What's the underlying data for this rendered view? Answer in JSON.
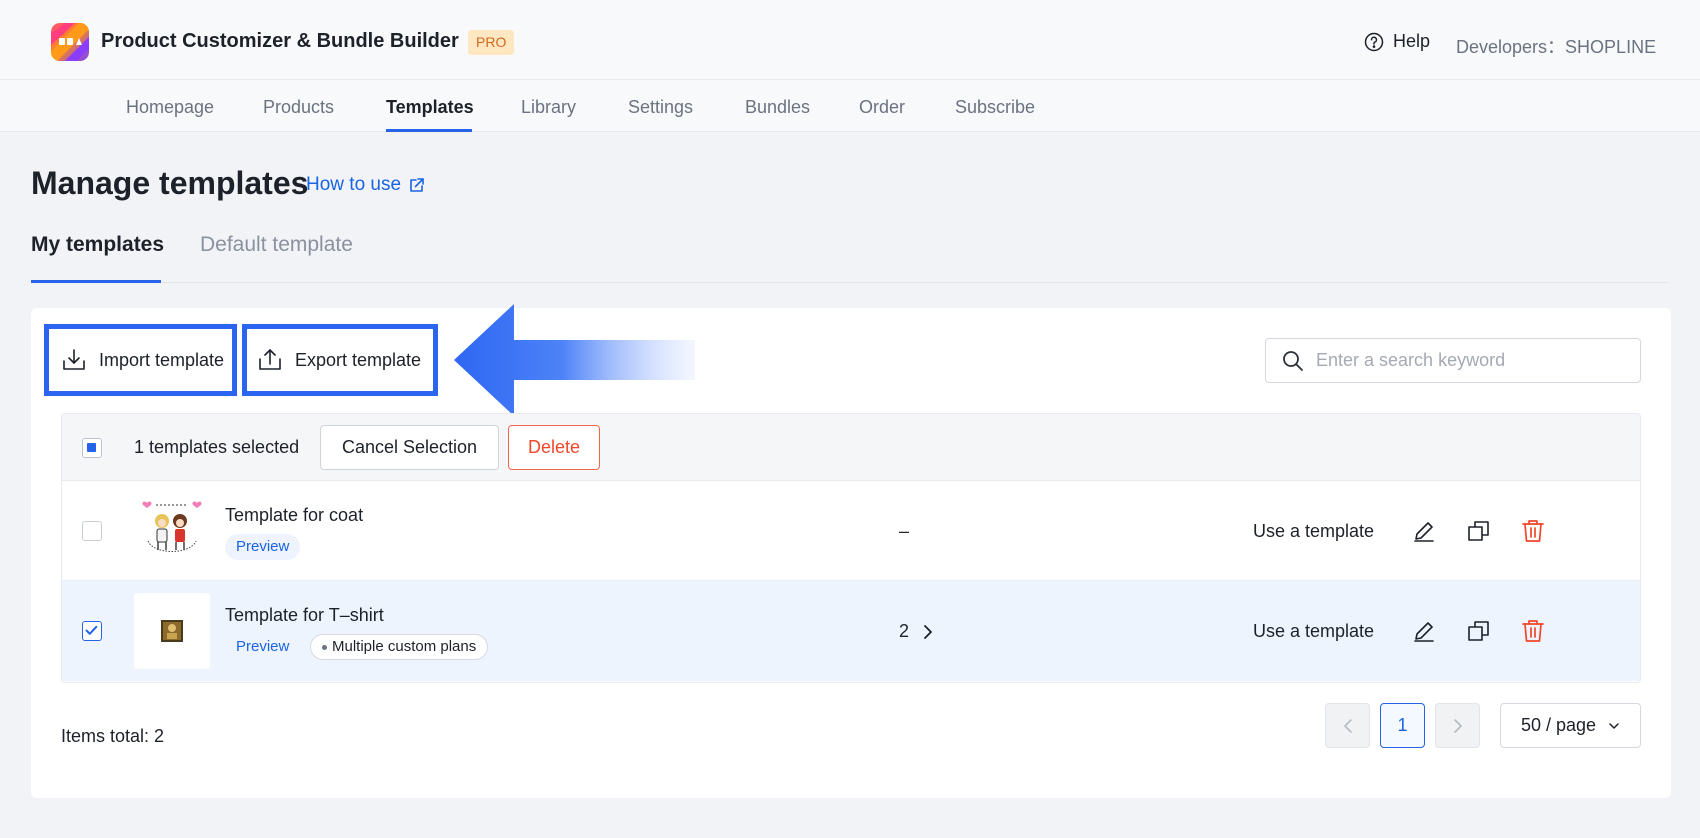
{
  "app": {
    "title": "Product Customizer & Bundle Builder",
    "badge": "PRO",
    "help_label": "Help",
    "developer_label": "Developers：SHOPLINE"
  },
  "nav": {
    "items": [
      {
        "label": "Homepage",
        "active": false
      },
      {
        "label": "Products",
        "active": false
      },
      {
        "label": "Templates",
        "active": true
      },
      {
        "label": "Library",
        "active": false
      },
      {
        "label": "Settings",
        "active": false
      },
      {
        "label": "Bundles",
        "active": false
      },
      {
        "label": "Order",
        "active": false
      },
      {
        "label": "Subscribe",
        "active": false
      }
    ]
  },
  "page": {
    "title": "Manage templates",
    "how_to_label": "How to use",
    "tabs": [
      {
        "label": "My templates",
        "active": true
      },
      {
        "label": "Default template",
        "active": false
      }
    ]
  },
  "toolbar": {
    "import_label": "Import template",
    "export_label": "Export template",
    "search_placeholder": "Enter a search keyword",
    "search_value": ""
  },
  "selection": {
    "text": "1 templates selected",
    "cancel_label": "Cancel Selection",
    "delete_label": "Delete"
  },
  "rows": [
    {
      "name": "Template for coat",
      "preview_label": "Preview",
      "tag": "",
      "count": "–",
      "use_label": "Use a template",
      "checked": false
    },
    {
      "name": "Template for T–shirt",
      "preview_label": "Preview",
      "tag": "Multiple custom plans",
      "count": "2",
      "use_label": "Use a template",
      "checked": true
    }
  ],
  "footer": {
    "total_label": "Items total: 2",
    "current_page": "1",
    "page_size": "50 / page"
  },
  "colors": {
    "accent": "#2563eb",
    "danger": "#f0462a",
    "highlight_border": "#2b64f0"
  },
  "icons": {
    "help": "question-circle-icon",
    "external": "external-link-icon",
    "import": "download-tray-icon",
    "export": "upload-tray-icon",
    "search": "search-icon",
    "edit": "pencil-icon",
    "copy": "copy-icon",
    "delete": "trash-icon",
    "annotation": "left-arrow-icon"
  }
}
